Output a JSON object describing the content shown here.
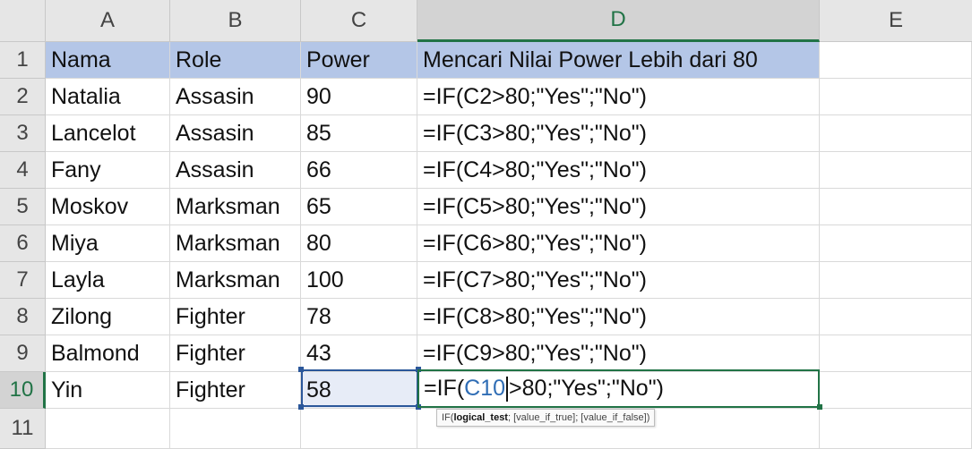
{
  "columns": [
    "A",
    "B",
    "C",
    "D",
    "E"
  ],
  "rows": [
    "1",
    "2",
    "3",
    "4",
    "5",
    "6",
    "7",
    "8",
    "9",
    "10",
    "11"
  ],
  "header": {
    "nama": "Nama",
    "role": "Role",
    "power": "Power",
    "formula_col": "Mencari Nilai Power Lebih dari 80"
  },
  "data": [
    {
      "nama": "Natalia",
      "role": "Assasin",
      "power": "90",
      "formula": "=IF(C2>80;\"Yes\";\"No\")"
    },
    {
      "nama": "Lancelot",
      "role": "Assasin",
      "power": "85",
      "formula": "=IF(C3>80;\"Yes\";\"No\")"
    },
    {
      "nama": "Fany",
      "role": "Assasin",
      "power": "66",
      "formula": "=IF(C4>80;\"Yes\";\"No\")"
    },
    {
      "nama": "Moskov",
      "role": "Marksman",
      "power": "65",
      "formula": "=IF(C5>80;\"Yes\";\"No\")"
    },
    {
      "nama": "Miya",
      "role": "Marksman",
      "power": "80",
      "formula": "=IF(C6>80;\"Yes\";\"No\")"
    },
    {
      "nama": "Layla",
      "role": "Marksman",
      "power": "100",
      "formula": "=IF(C7>80;\"Yes\";\"No\")"
    },
    {
      "nama": "Zilong",
      "role": "Fighter",
      "power": "78",
      "formula": "=IF(C8>80;\"Yes\";\"No\")"
    },
    {
      "nama": "Balmond",
      "role": "Fighter",
      "power": "43",
      "formula": "=IF(C9>80;\"Yes\";\"No\")"
    },
    {
      "nama": "Yin",
      "role": "Fighter",
      "power": "58",
      "formula": ""
    }
  ],
  "editing": {
    "prefix": "=IF(",
    "ref": "C10",
    "suffix": ">80;\"Yes\";\"No\")"
  },
  "tooltip": {
    "fn": "IF(",
    "arg1": "logical_test",
    "rest": "; [value_if_true]; [value_if_false])"
  },
  "colors": {
    "header_fill": "#b4c6e7",
    "active_green": "#217346",
    "ref_blue": "#2b579a"
  }
}
